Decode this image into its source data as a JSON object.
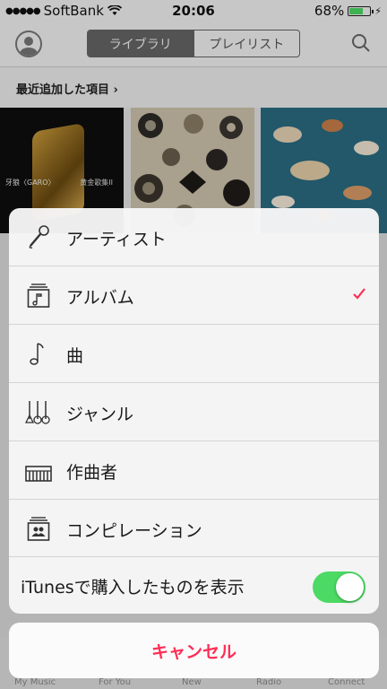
{
  "status": {
    "carrier": "SoftBank",
    "time": "20:06",
    "battery": "68%",
    "battery_level": 0.68
  },
  "nav": {
    "tabs": [
      "ライブラリ",
      "プレイリスト"
    ],
    "active_tab": 0
  },
  "section": {
    "title": "最近追加した項目 ›"
  },
  "albums": [
    {
      "title_left": "牙狼〈GARO〉",
      "title_right": "黄金歌集II"
    }
  ],
  "tabbar": {
    "items": [
      "My Music",
      "For You",
      "New",
      "Radio",
      "Connect"
    ]
  },
  "menu": {
    "items": [
      {
        "label": "アーティスト",
        "icon": "microphone-icon",
        "selected": false
      },
      {
        "label": "アルバム",
        "icon": "album-icon",
        "selected": true
      },
      {
        "label": "曲",
        "icon": "music-note-icon",
        "selected": false
      },
      {
        "label": "ジャンル",
        "icon": "genre-icon",
        "selected": false
      },
      {
        "label": "作曲者",
        "icon": "piano-icon",
        "selected": false
      },
      {
        "label": "コンピレーション",
        "icon": "compilation-icon",
        "selected": false
      }
    ],
    "itunes_label": "iTunesで購入したものを表示",
    "itunes_toggle_on": true,
    "cancel_label": "キャンセル"
  },
  "colors": {
    "accent": "#ff2d55",
    "toggle_on": "#4cd964"
  }
}
